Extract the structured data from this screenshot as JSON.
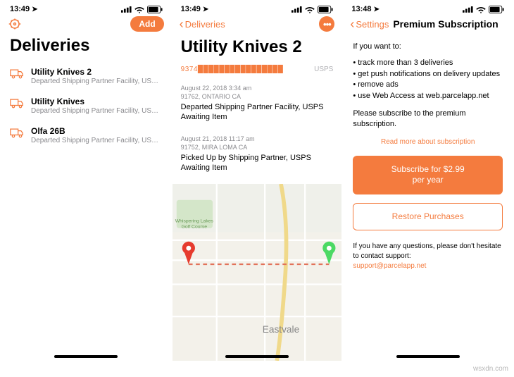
{
  "accent": "#f47b3e",
  "statusbar": {
    "time_a": "13:49",
    "time_b": "13:49",
    "time_c": "13:48"
  },
  "screen1": {
    "add_label": "Add",
    "title": "Deliveries",
    "items": [
      {
        "title": "Utility Knives 2",
        "sub": "Departed Shipping Partner Facility, USPS Aw…"
      },
      {
        "title": "Utility Knives",
        "sub": "Departed Shipping Partner Facility, USPS Aw…"
      },
      {
        "title": "Olfa 26B",
        "sub": "Departed Shipping Partner Facility, USPS Aw…"
      }
    ]
  },
  "screen2": {
    "back_label": "Deliveries",
    "title": "Utility Knives 2",
    "tracking_number": "9374████████████████",
    "carrier": "USPS",
    "events": [
      {
        "date": "August 22, 2018 3:34 am",
        "loc": "91762, ONTARIO CA",
        "desc": "Departed Shipping Partner Facility, USPS Awaiting Item"
      },
      {
        "date": "August 21, 2018 11:17 am",
        "loc": "91752, MIRA LOMA CA",
        "desc": "Picked Up by Shipping Partner, USPS Awaiting Item"
      }
    ],
    "map_label_golf": "Whispering Lakes Golf Course",
    "map_label_town": "Eastvale"
  },
  "screen3": {
    "back_label": "Settings",
    "title": "Premium Subscription",
    "intro": "If you want to:",
    "bullets": [
      "track more than 3 deliveries",
      "get push notifications on delivery updates",
      "remove ads",
      "use Web Access at web.parcelapp.net"
    ],
    "please": "Please subscribe to the premium subscription.",
    "read_more": "Read more about subscription",
    "subscribe_line1": "Subscribe for $2.99",
    "subscribe_line2": "per year",
    "restore": "Restore Purchases",
    "support_text": "If you have any questions, please don't hesitate to contact support:",
    "support_email": "support@parcelapp.net"
  },
  "watermark": "wsxdn.com"
}
